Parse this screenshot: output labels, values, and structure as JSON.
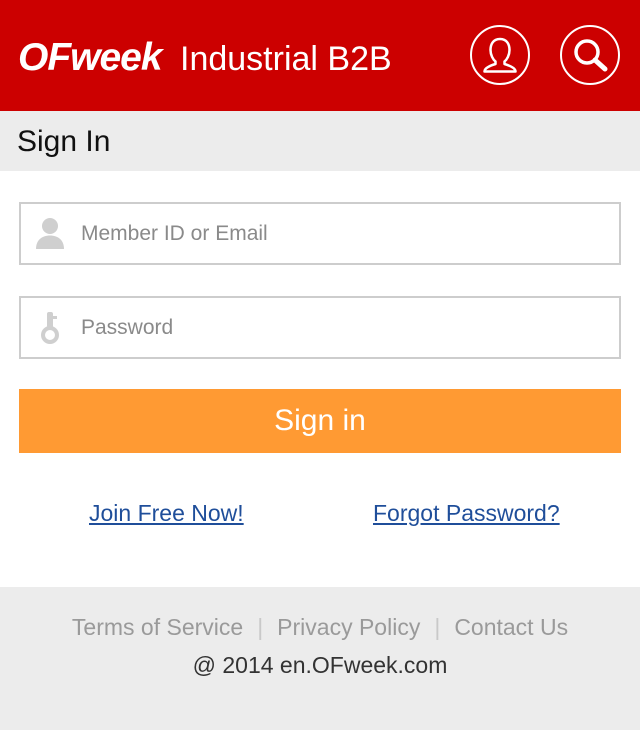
{
  "header": {
    "logo_text": "OFweek",
    "title": "Industrial B2B",
    "background": "#cc0000",
    "user_icon": "user-icon",
    "search_icon": "search-icon"
  },
  "page": {
    "title": "Sign In"
  },
  "form": {
    "username_placeholder": "Member ID or Email",
    "username_value": "",
    "password_placeholder": "Password",
    "password_value": "",
    "submit_label": "Sign in",
    "submit_color": "#ff9a33"
  },
  "links": {
    "join": "Join Free Now!",
    "forgot": "Forgot Password?"
  },
  "footer": {
    "terms": "Terms of Service",
    "separator": "|",
    "privacy": "Privacy Policy",
    "contact": "Contact Us",
    "copyright": "@ 2014 en.OFweek.com"
  }
}
